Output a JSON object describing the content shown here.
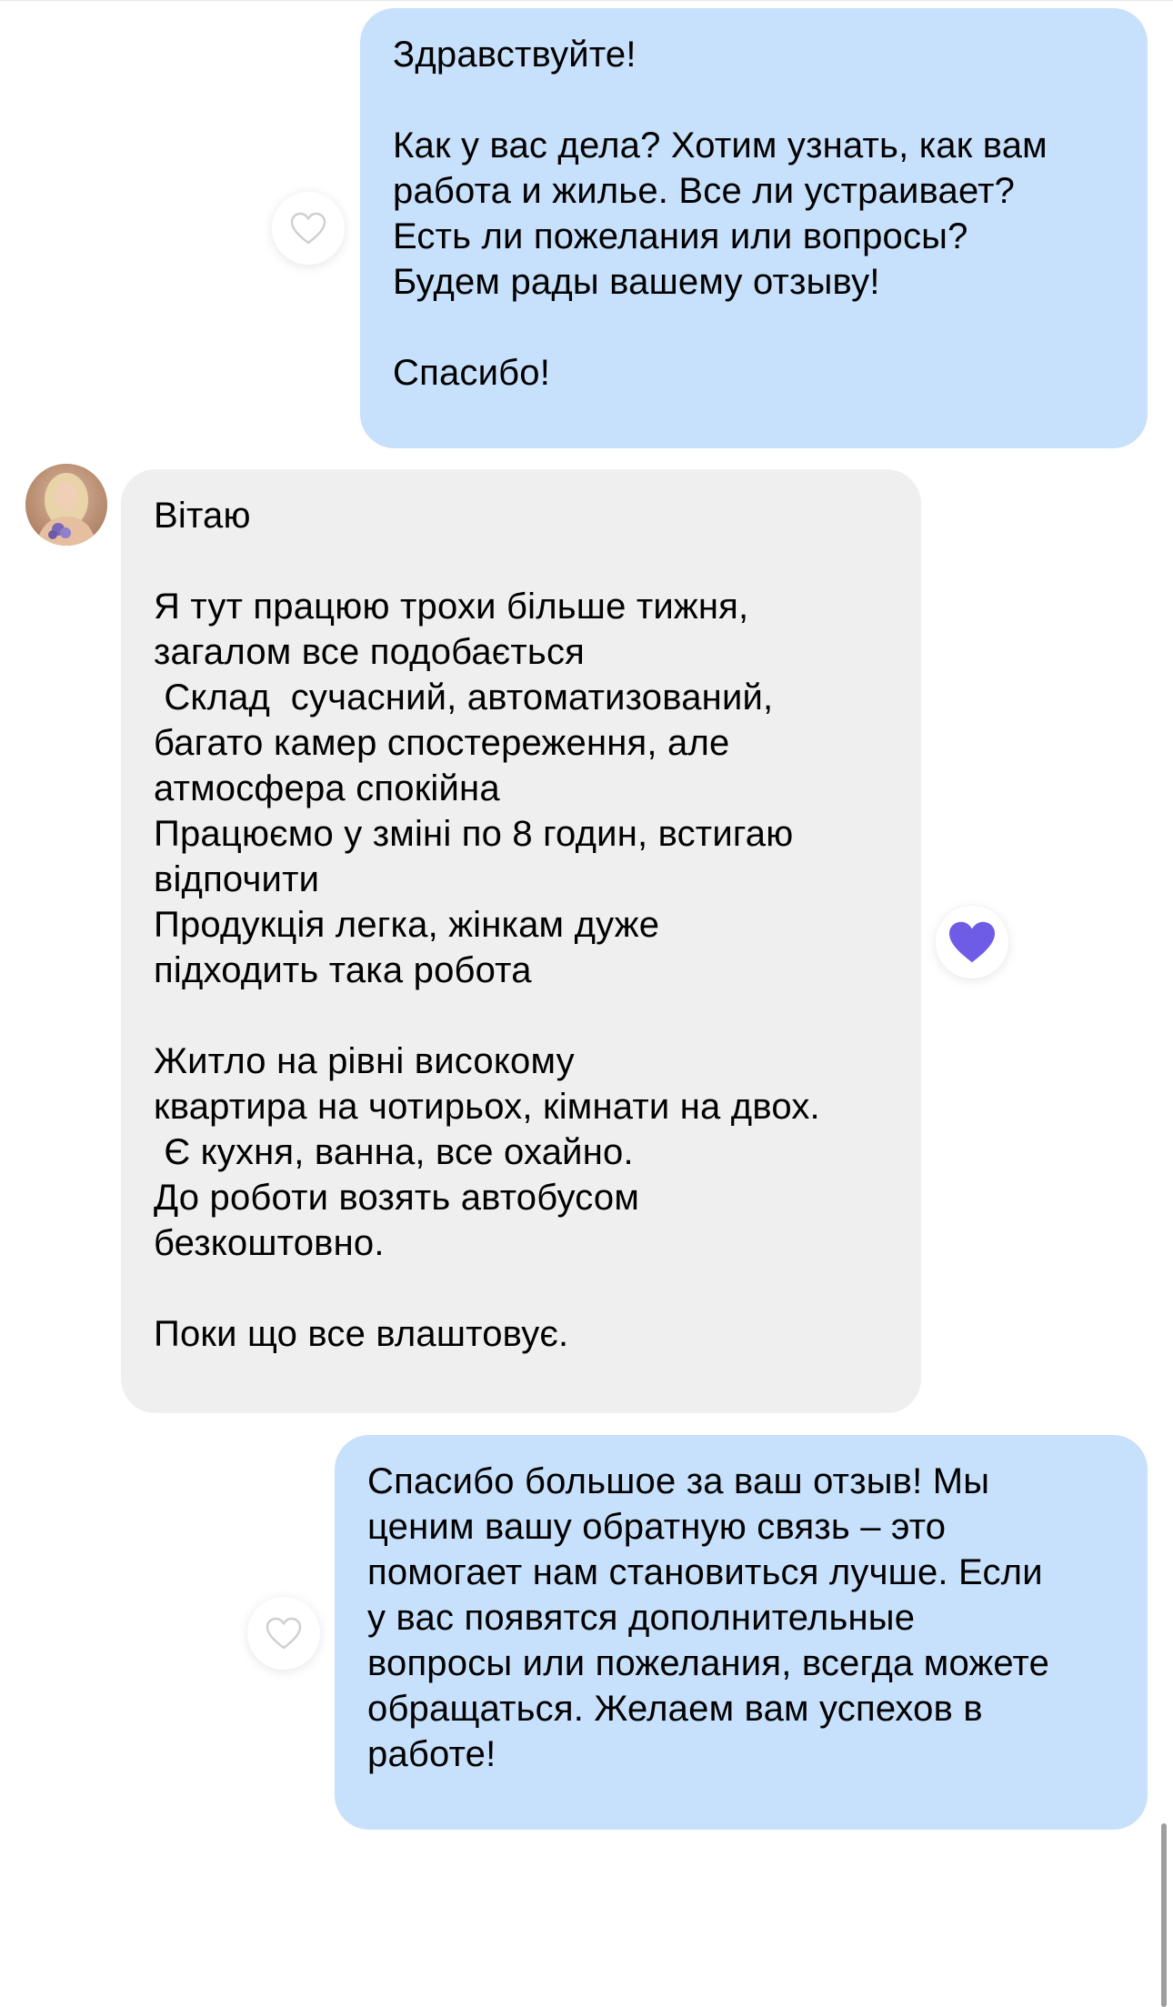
{
  "colors": {
    "outgoing_bubble": "#c7e0fb",
    "incoming_bubble": "#efefef",
    "like_active": "#6e5ce6",
    "like_inactive": "#cfcfcf"
  },
  "messages": [
    {
      "direction": "outgoing",
      "text": "Здравствуйте!\n\nКак у вас дела? Хотим узнать, как вам\nработа и жилье. Все ли устраивает?\nЕсть ли пожелания или вопросы?\nБудем рады вашему отзыву!\n\nСпасибо!",
      "like_icon": "heart-outline-icon",
      "liked": false
    },
    {
      "direction": "incoming",
      "avatar_icon": "user-avatar-photo",
      "text": "Вітаю\n\nЯ тут працюю трохи більше тижня,\nзагалом все подобається\n Склад  сучасний, автоматизований,\nбагато камер спостереження, але\nатмосфера спокійна\nПрацюємо у зміні по 8 годин, встигаю\nвідпочити\nПродукція легка, жінкам дуже\nпідходить така робота\n\nЖитло на рівні високому\nквартира на чотирьох, кімнати на двох.\n Є кухня, ванна, все охайно.\nДо роботи возять автобусом\nбезкоштовно.\n\nПоки що все влаштовує.",
      "like_icon": "heart-filled-icon",
      "liked": true
    },
    {
      "direction": "outgoing",
      "text": "Спасибо большое за ваш отзыв! Мы\nценим вашу обратную связь – это\nпомогает нам становиться лучше. Если\nу вас появятся дополнительные\nвопросы или пожелания, всегда можете\nобращаться. Желаем вам успехов в\nработе!",
      "like_icon": "heart-outline-icon",
      "liked": false
    }
  ]
}
